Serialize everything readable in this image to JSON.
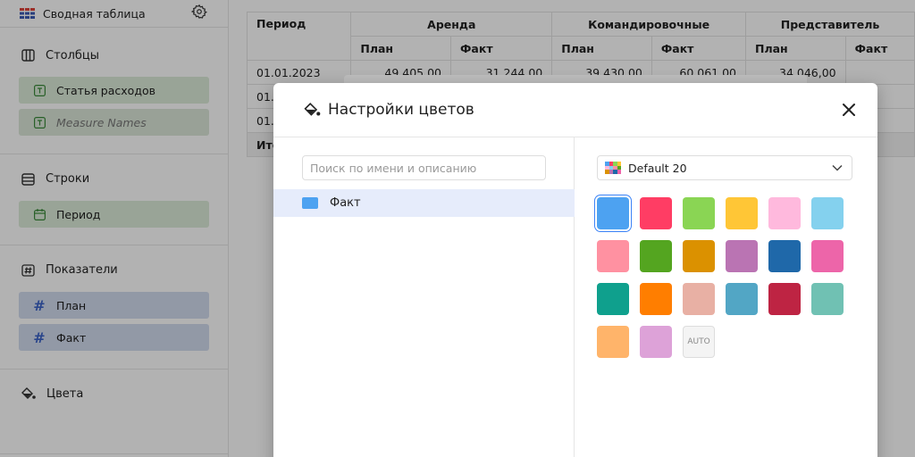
{
  "sidebar": {
    "header_title": "Сводная таблица",
    "sections": {
      "columns_label": "Столбцы",
      "rows_label": "Строки",
      "measures_label": "Показатели",
      "colors_label": "Цвета"
    },
    "column_chips": [
      "Статья расходов",
      "Measure Names"
    ],
    "row_chips": [
      "Период"
    ],
    "measure_chips": [
      "План",
      "Факт"
    ]
  },
  "table": {
    "header_period": "Период",
    "groups": [
      "Аренда",
      "Командировочные",
      "Представитель"
    ],
    "subheaders": [
      "План",
      "Факт",
      "План",
      "Факт",
      "План",
      "Факт"
    ],
    "rows": [
      {
        "period": "01.01.2023",
        "values": [
          "49 405,00",
          "31 244,00",
          "39 430,00",
          "60 061,00",
          "34 046,00",
          ""
        ]
      },
      {
        "period": "01.",
        "values": [
          "",
          "",
          "",
          "",
          "",
          ""
        ]
      },
      {
        "period": "01.",
        "values": [
          "",
          "",
          "",
          "",
          "",
          ""
        ]
      }
    ],
    "total_label": "Ито"
  },
  "dialog": {
    "title": "Настройки цветов",
    "search_placeholder": "Поиск по имени и описанию",
    "items": [
      {
        "label": "Факт",
        "color": "#4da2f1"
      }
    ],
    "palette_name": "Default 20",
    "auto_label": "AUTO",
    "palette": [
      "#4da2f1",
      "#ff3d64",
      "#8ad554",
      "#ffc636",
      "#ffb9dd",
      "#84d1ee",
      "#ff91a1",
      "#54a520",
      "#db9100",
      "#ba74b3",
      "#1f68a9",
      "#ed65a9",
      "#0fa08d",
      "#ff7e00",
      "#e8b0a4",
      "#52a6c5",
      "#be2443",
      "#70c1b3",
      "#ffb46a",
      "#dda2d8"
    ],
    "selected_index": 0
  }
}
